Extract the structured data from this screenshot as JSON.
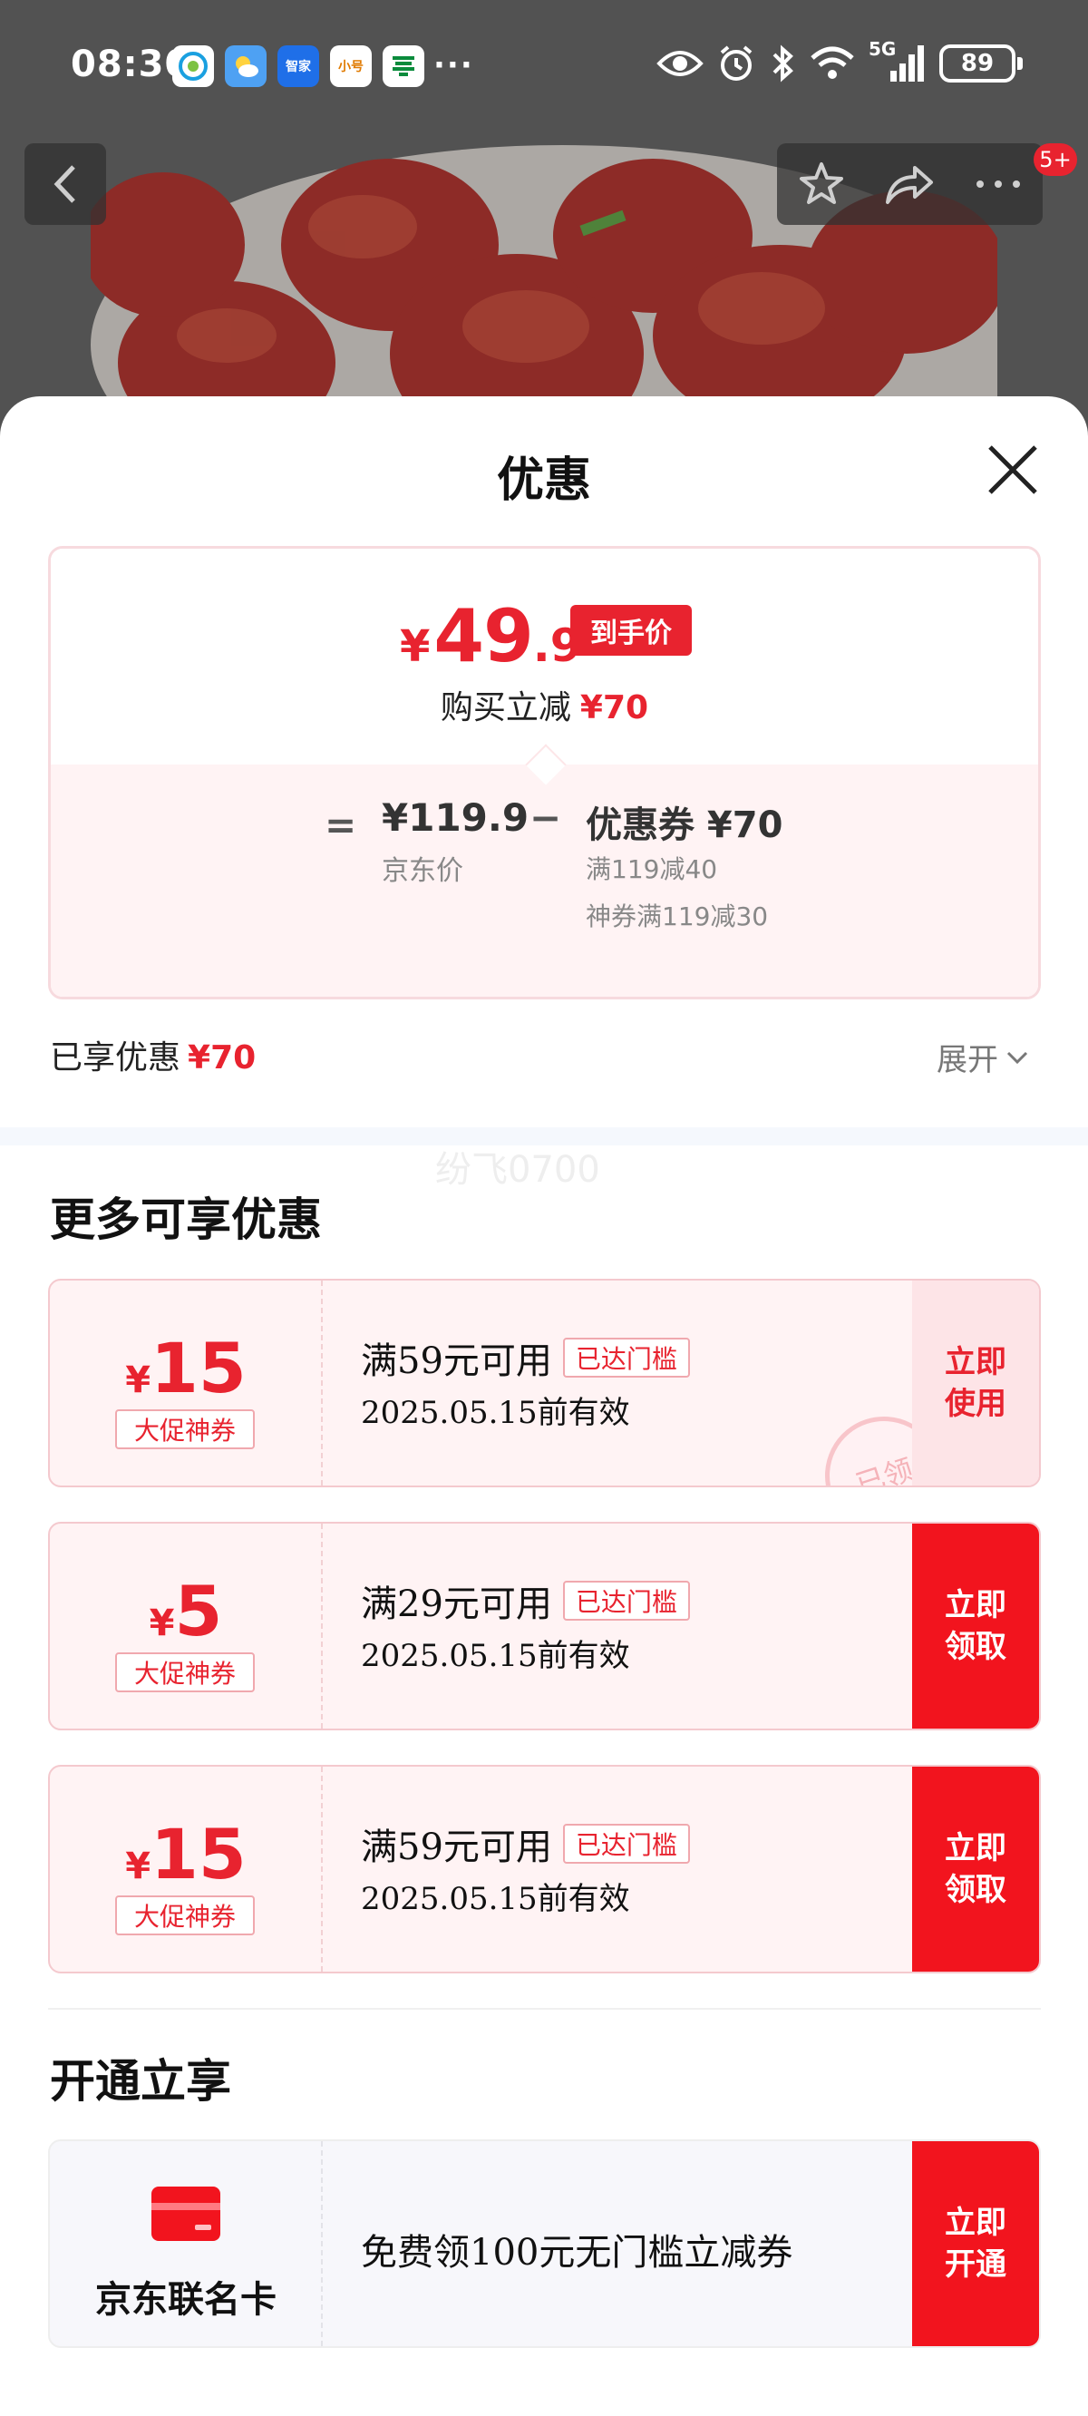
{
  "status_bar": {
    "time": "08:30",
    "app_icons": [
      {
        "name": "china-mobile-icon",
        "text": "",
        "color": "#ffffff"
      },
      {
        "name": "weather-icon",
        "text": "",
        "color": "#4ea1f3"
      },
      {
        "name": "smart-home-icon",
        "text": "智家",
        "color": "#1f6fe8"
      },
      {
        "name": "xiaohao-icon",
        "text": "小号",
        "color": "#ffffff"
      },
      {
        "name": "china-post-icon",
        "text": "",
        "color": "#ffffff"
      }
    ],
    "more": "···",
    "network": "5G",
    "battery": "89"
  },
  "page_nav": {
    "badge": "5+"
  },
  "sheet": {
    "title": "优惠",
    "summary": {
      "currency": "¥",
      "final_int": "49",
      "final_dec": ".9",
      "arrive_tag": "到手价",
      "instant_cut_label": "购买立减",
      "instant_cut_amount": "¥70",
      "equals": "=",
      "jd_price": "¥119.9",
      "jd_label": "京东价",
      "minus": "−",
      "coupon_head": "优惠券 ¥70",
      "coupon_detail_1": "满119减40",
      "coupon_detail_2": "神券满119减30"
    },
    "enjoyed_label": "已享优惠",
    "enjoyed_amount": "¥70",
    "expand_label": "展开",
    "watermark": "纷飞0700",
    "more_title": "更多可享优惠",
    "coupons": [
      {
        "currency": "¥",
        "amount": "15",
        "tag": "大促神券",
        "condition": "满59元可用",
        "reached": "已达门槛",
        "valid": "2025.05.15前有效",
        "button": "立即\n使用",
        "stamp": "已领"
      },
      {
        "currency": "¥",
        "amount": "5",
        "tag": "大促神券",
        "condition": "满29元可用",
        "reached": "已达门槛",
        "valid": "2025.05.15前有效",
        "button": "立即\n领取"
      },
      {
        "currency": "¥",
        "amount": "15",
        "tag": "大促神券",
        "condition": "满59元可用",
        "reached": "已达门槛",
        "valid": "2025.05.15前有效",
        "button": "立即\n领取"
      }
    ],
    "open_title": "开通立享",
    "member": {
      "card_name": "京东联名卡",
      "offer": "免费领100元无门槛立减券",
      "button": "立即\n开通"
    }
  },
  "colors": {
    "accent": "#e8232f",
    "button_red": "#f2141e"
  }
}
